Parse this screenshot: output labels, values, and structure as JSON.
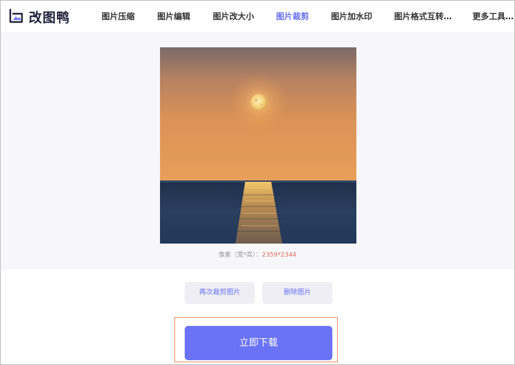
{
  "app": {
    "name": "改图鸭"
  },
  "nav": {
    "items": [
      {
        "label": "图片压缩",
        "active": false
      },
      {
        "label": "图片编辑",
        "active": false
      },
      {
        "label": "图片改大小",
        "active": false
      },
      {
        "label": "图片裁剪",
        "active": true
      },
      {
        "label": "图片加水印",
        "active": false
      },
      {
        "label": "图片格式互转…",
        "active": false
      },
      {
        "label": "更多工具…",
        "active": false
      }
    ]
  },
  "preview": {
    "pixel_label": "像素（宽*高）：",
    "pixel_value": "2359*2344"
  },
  "actions": {
    "recrop_label": "再次裁剪图片",
    "delete_label": "删除图片",
    "download_label": "立即下载"
  },
  "colors": {
    "accent": "#6a73f5",
    "highlight": "#ef8a5f",
    "pixel_value": "#e06a5a"
  }
}
